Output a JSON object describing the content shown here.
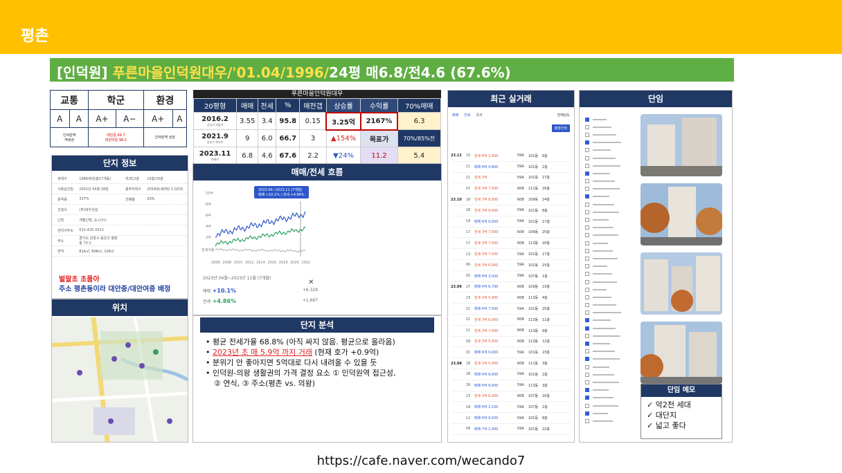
{
  "header": {
    "title": "평촌"
  },
  "banner": {
    "part1": "[인덕원] ",
    "part2": "푸른마을인덕원대우/'01.04/1996/",
    "part3": "24평 매6.8/전4.6 (67.6%)"
  },
  "grades": {
    "headers": [
      "교통",
      "학군",
      "환경"
    ],
    "values": [
      "A",
      "A",
      "A+",
      "A−",
      "A+",
      "A"
    ],
    "notes": [
      "인덕원역\n역세권",
      "대민중 69.7\n대민여중 98.2",
      "인덕원역 상권"
    ]
  },
  "complex_table": {
    "title": "푸른마을인덕원대우",
    "headers": [
      "20평형",
      "매매",
      "전세",
      "%",
      "매전갭",
      "상승률",
      "수익률",
      "70%매매"
    ],
    "rows": [
      {
        "date": "2016.2",
        "sub": "상승기 저점가",
        "sale": "3.55",
        "jeonse": "3.4",
        "pct": "95.8",
        "gap": "0.15",
        "rise": "3.25억",
        "yield": "2167%",
        "p70": "6.3"
      },
      {
        "date": "2021.9",
        "sub": "상승기 최고가",
        "sale": "9",
        "jeonse": "6.0",
        "pct": "66.7",
        "gap": "3",
        "rise": "▲154%",
        "yield": "목표가",
        "p70": "70%/85%전"
      },
      {
        "date": "2023.11",
        "sub": "현재가",
        "sale": "6.8",
        "jeonse": "4.6",
        "pct": "67.6",
        "gap": "2.2",
        "rise": "▼24%",
        "yield": "11.2",
        "p70": "5.4"
      }
    ]
  },
  "complex_info": {
    "title": "단지 정보",
    "rows": [
      {
        "k": "세대수",
        "v": "1996세대(총17개동)",
        "k2": "저/최고층",
        "v2": "15층/25층"
      },
      {
        "k": "사용승인일",
        "v": "2001년 04월 28일",
        "k2": "총주차대수",
        "v2": "2054대(세대당 1.02대)"
      },
      {
        "k": "용적률",
        "v": "337%",
        "k2": "건폐율",
        "v2": "20%"
      },
      {
        "k": "건설사",
        "v": "(주)대우건설",
        "k2": "",
        "v2": ""
      },
      {
        "k": "난방",
        "v": "개별난방, 도시가스",
        "k2": "",
        "v2": ""
      },
      {
        "k": "관리사무소",
        "v": "031-425-3313",
        "k2": "",
        "v2": ""
      },
      {
        "k": "주소",
        "v": "경기도 안양시 동안구 평촌동 73-2",
        "k2": "",
        "v2": ""
      },
      {
        "k": "면적",
        "v": "81A㎡, 89B㎡, 108㎡",
        "k2": "",
        "v2": ""
      }
    ],
    "note1": "벌말초 초품아",
    "note2": "주소 평촌동이라 대안중/대안여중 배정"
  },
  "location": {
    "title": "위치"
  },
  "flow": {
    "title": "매매/전세 흐름",
    "tooltip_period": "2023.04~2023.11 (7개월)",
    "tooltip_values": "매매 +10.1% / 전세 +4.86%",
    "y_ticks": [
      "10억",
      "8억",
      "6억",
      "4억",
      "2억"
    ],
    "x_ticks": [
      "2006",
      "2008",
      "2010",
      "2012",
      "2014",
      "2016",
      "2018",
      "2020",
      "2022"
    ],
    "legend_left": "전세가율",
    "summary_period": "2023년 04월~2023년 11월 (7개월)",
    "close": "✕",
    "sale_label": "매매",
    "sale_pct": "+10.1%",
    "sale_amt": "+6,329",
    "jeonse_label": "전세",
    "jeonse_pct": "+4.86%",
    "jeonse_amt": "+1,667"
  },
  "analysis": {
    "title": "단지 분석",
    "bullets": [
      "평균 전세가율 68.8% (아직 싸지 않음. 평균으로 올라옴)",
      "2023년 초 매 5.9억 까지 거래",
      " (현재 호가 +0.9억)",
      "분위기 안 좋아지면 5억대로 다시 내려올 수 있을 듯",
      "인덕원-의왕 생활권의 가격 결정 요소 ① 인덕원역 접근성,",
      "② 연식, ③ 주소(평촌 vs. 의왕)"
    ]
  },
  "transactions": {
    "title": "최근 실거래",
    "filters": [
      "매매",
      "전세",
      "월세"
    ],
    "sort": "전체년도",
    "btn": "평형선택",
    "rows": [
      {
        "m": "23.11",
        "d": "15",
        "t": "전세 4억 1,000",
        "a": "59A",
        "u": "101동",
        "f": "6층"
      },
      {
        "m": "",
        "d": "11",
        "t": "매매 6억 4,800",
        "a": "59A",
        "u": "101동",
        "f": "2층"
      },
      {
        "m": "",
        "d": "11",
        "t": "전세 3억",
        "a": "59A",
        "u": "101동",
        "f": "17층"
      },
      {
        "m": "",
        "d": "07",
        "t": "전세 3억 7,000",
        "a": "60B",
        "u": "111동",
        "f": "16층"
      },
      {
        "m": "23.10",
        "d": "28",
        "t": "전세 3억 8,000",
        "a": "60B",
        "u": "109동",
        "f": "24층"
      },
      {
        "m": "",
        "d": "28",
        "t": "전세 3억 9,000",
        "a": "59A",
        "u": "101동",
        "f": "8층"
      },
      {
        "m": "",
        "d": "19",
        "t": "매매 6억 9,000",
        "a": "59A",
        "u": "101동",
        "f": "17층"
      },
      {
        "m": "",
        "d": "17",
        "t": "전세 3억 7,000",
        "a": "60B",
        "u": "109동",
        "f": "25층"
      },
      {
        "m": "",
        "d": "17",
        "t": "전세 3억 7,000",
        "a": "60B",
        "u": "113동",
        "f": "16층"
      },
      {
        "m": "",
        "d": "13",
        "t": "전세 3억 7,000",
        "a": "59A",
        "u": "101동",
        "f": "17층"
      },
      {
        "m": "",
        "d": "06",
        "t": "전세 3억 6,000",
        "a": "59A",
        "u": "101동",
        "f": "15층"
      },
      {
        "m": "",
        "d": "05",
        "t": "매매 6억 3,000",
        "a": "59A",
        "u": "107동",
        "f": "1층"
      },
      {
        "m": "23.09",
        "d": "27",
        "t": "매매 6억 6,700",
        "a": "60B",
        "u": "109동",
        "f": "23층"
      },
      {
        "m": "",
        "d": "23",
        "t": "전세 3억 5,000",
        "a": "60B",
        "u": "113동",
        "f": "4층"
      },
      {
        "m": "",
        "d": "21",
        "t": "매매 6억 7,000",
        "a": "59A",
        "u": "101동",
        "f": "25층"
      },
      {
        "m": "",
        "d": "21",
        "t": "전세 3억 6,000",
        "a": "60B",
        "u": "113동",
        "f": "11층"
      },
      {
        "m": "",
        "d": "11",
        "t": "전세 3억 7,000",
        "a": "60B",
        "u": "113동",
        "f": "9층"
      },
      {
        "m": "",
        "d": "09",
        "t": "전세 3억 5,500",
        "a": "60B",
        "u": "113동",
        "f": "12층"
      },
      {
        "m": "",
        "d": "01",
        "t": "매매 6억 9,000",
        "a": "59A",
        "u": "101동",
        "f": "23층"
      },
      {
        "m": "23.08",
        "d": "29",
        "t": "전세 3억 5,000",
        "a": "60B",
        "u": "111동",
        "f": "3층"
      },
      {
        "m": "",
        "d": "28",
        "t": "매매 6억 9,000",
        "a": "59A",
        "u": "101동",
        "f": "2층"
      },
      {
        "m": "",
        "d": "26",
        "t": "매매 6억 9,000",
        "a": "59A",
        "u": "113동",
        "f": "3층"
      },
      {
        "m": "",
        "d": "23",
        "t": "전세 3억 6,000",
        "a": "60B",
        "u": "107동",
        "f": "16층"
      },
      {
        "m": "",
        "d": "18",
        "t": "매매 6억 2,100",
        "a": "59A",
        "u": "107동",
        "f": "1층"
      },
      {
        "m": "",
        "d": "12",
        "t": "매매 6억 9,500",
        "a": "59A",
        "u": "101동",
        "f": "8층"
      },
      {
        "m": "",
        "d": "09",
        "t": "매매 7억 1,000",
        "a": "59A",
        "u": "101동",
        "f": "22층"
      }
    ]
  },
  "site": {
    "title": "단임",
    "memo_title": "단임 메모",
    "memo": [
      "✓ 악2천 세대",
      "✓ 대단지",
      "✓ 넓고 좋다"
    ]
  },
  "footer": {
    "url": "https://cafe.naver.com/wecando7"
  }
}
